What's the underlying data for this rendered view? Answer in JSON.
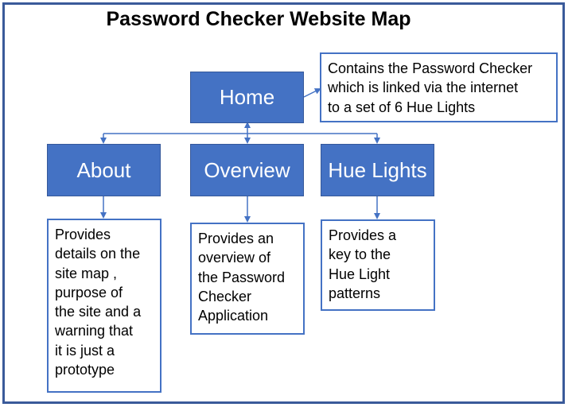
{
  "title": "Password Checker Website Map",
  "nodes": {
    "home": "Home",
    "about": "About",
    "overview": "Overview",
    "hue_lights": "Hue Lights"
  },
  "notes": {
    "home": [
      "Contains the Password Checker",
      "which is linked via the internet",
      "to a set of 6 Hue Lights"
    ],
    "about": [
      "Provides",
      "details on the",
      "site map ,",
      "purpose of",
      "the site and a",
      "warning that",
      "it is just a",
      "prototype"
    ],
    "overview": [
      "Provides an",
      "overview of",
      "the Password",
      "Checker",
      "Application"
    ],
    "hue_lights": [
      "Provides a",
      "key to the",
      "Hue Light",
      "patterns"
    ]
  },
  "colors": {
    "node_fill": "#4472c4",
    "frame": "#3a5a9a",
    "connector": "#4472c4"
  }
}
